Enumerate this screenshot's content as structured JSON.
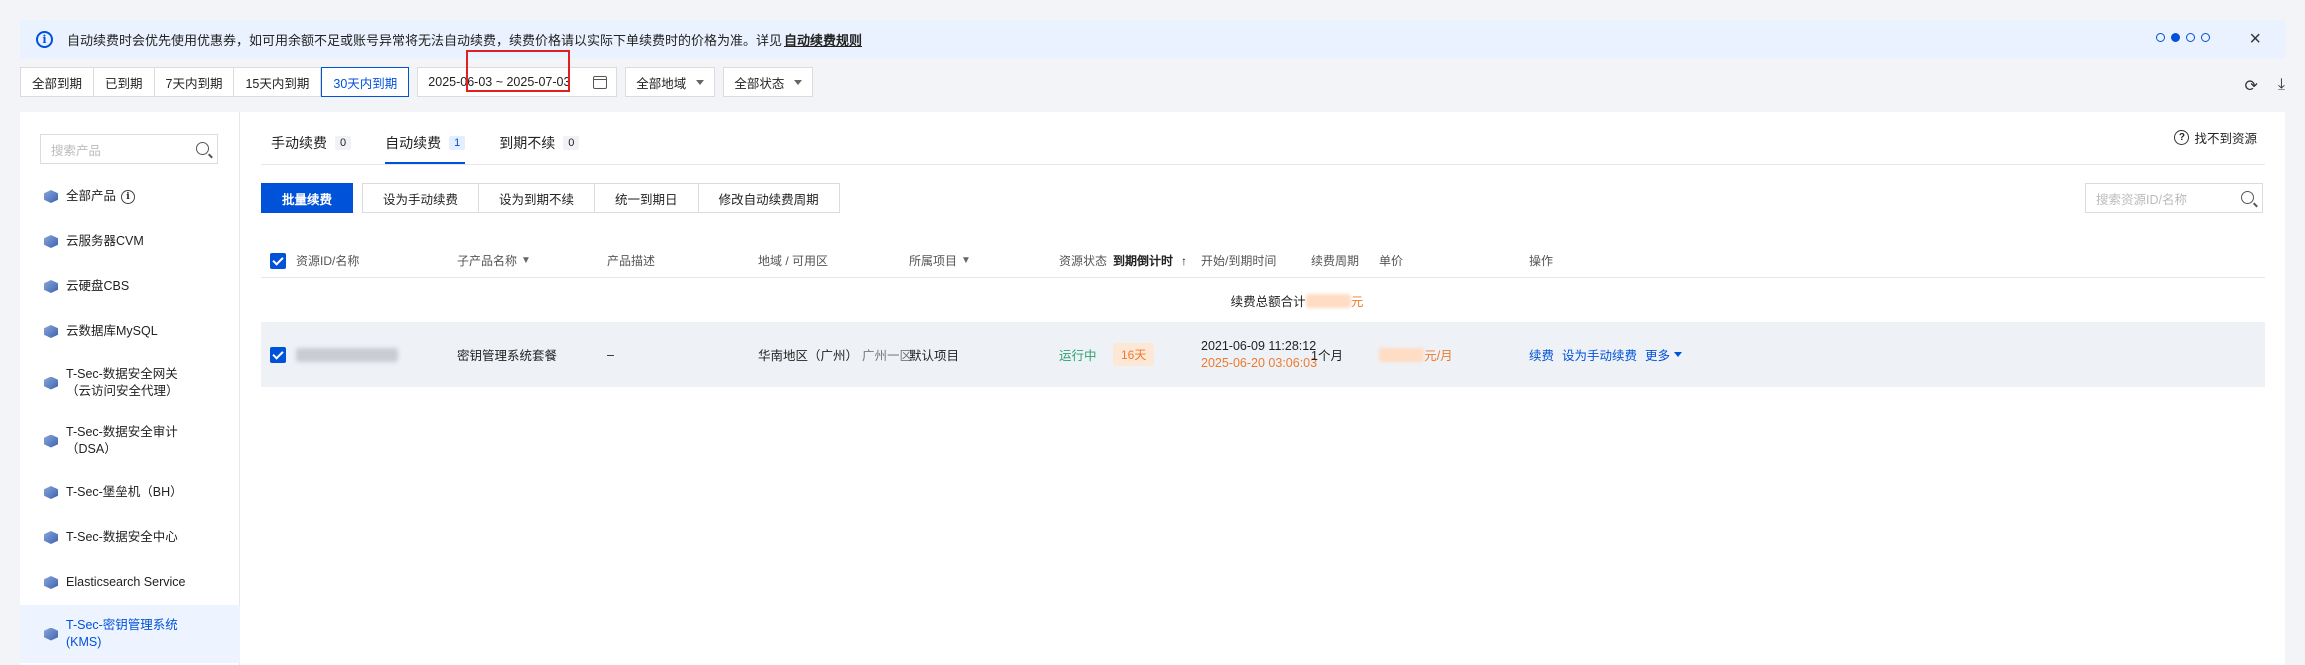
{
  "banner": {
    "text": "自动续费时会优先使用优惠券，如可用余额不足或账号异常将无法自动续费，续费价格请以实际下单续费时的价格为准。详见",
    "link": "自动续费规则",
    "close": "×"
  },
  "filters": {
    "segments": [
      "全部到期",
      "已到期",
      "7天内到期",
      "15天内到期",
      "30天内到期"
    ],
    "active_segment": "30天内到期",
    "date_range": "2025-06-03   ~ 2025-07-03",
    "region": "全部地域",
    "status": "全部状态"
  },
  "sidebar": {
    "search_placeholder": "搜索产品",
    "items": [
      {
        "label": "全部产品"
      },
      {
        "label": "云服务器CVM"
      },
      {
        "label": "云硬盘CBS"
      },
      {
        "label": "云数据库MySQL"
      },
      {
        "label": "T-Sec-数据安全网关（云访问安全代理）"
      },
      {
        "label": "T-Sec-数据安全审计（DSA）"
      },
      {
        "label": "T-Sec-堡垒机（BH）"
      },
      {
        "label": "T-Sec-数据安全中心"
      },
      {
        "label": "Elasticsearch Service"
      },
      {
        "label": "T-Sec-密钥管理系统(KMS)"
      }
    ]
  },
  "tabs": [
    {
      "label": "手动续费",
      "count": "0"
    },
    {
      "label": "自动续费",
      "count": "1"
    },
    {
      "label": "到期不续",
      "count": "0"
    }
  ],
  "not_found": "找不到资源",
  "actions": {
    "batch_renew": "批量续费",
    "set_manual": "设为手动续费",
    "set_no_renew": "设为到期不续",
    "unify_date": "统一到期日",
    "modify_period": "修改自动续费周期"
  },
  "resource_search_placeholder": "搜索资源ID/名称",
  "table": {
    "headers": {
      "id": "资源ID/名称",
      "sub_product": "子产品名称",
      "desc": "产品描述",
      "region": "地域 / 可用区",
      "project": "所属项目",
      "status": "资源状态",
      "countdown": "到期倒计时",
      "time": "开始/到期时间",
      "period": "续费周期",
      "price": "单价",
      "ops": "操作"
    },
    "summary_label": "续费总额合计",
    "summary_unit": "元",
    "row": {
      "sub_product": "密钥管理系统套餐",
      "desc": "–",
      "region": "华南地区（广州）",
      "zone": "广州一区",
      "project": "默认项目",
      "status": "运行中",
      "countdown": "16天",
      "start": "2021-06-09 11:28:12",
      "end": "2025-06-20 03:06:03",
      "period": "1个月",
      "price_unit": "元/月",
      "op_renew": "续费",
      "op_manual": "设为手动续费",
      "op_more": "更多"
    }
  }
}
